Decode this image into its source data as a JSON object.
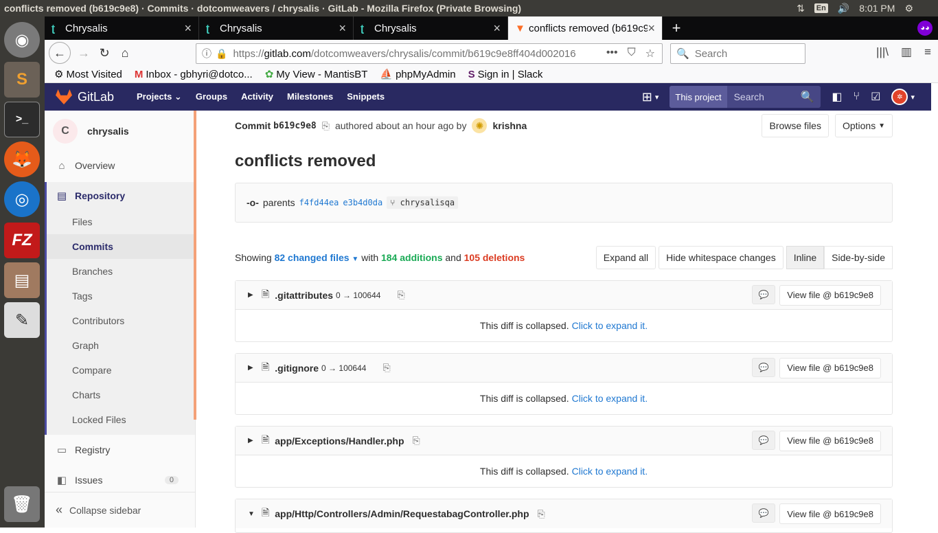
{
  "os": {
    "window_title": "conflicts removed (b619c9e8) · Commits · dotcomweavers / chrysalis · GitLab - Mozilla Firefox (Private Browsing)",
    "lang": "En",
    "clock": "8:01 PM"
  },
  "launcher": {
    "apps": [
      "ubuntu-dash",
      "sublime-text",
      "terminal",
      "firefox",
      "chromium",
      "filezilla",
      "file-manager",
      "text-editor",
      "trash"
    ]
  },
  "browser": {
    "tabs": [
      {
        "label": "Chrysalis"
      },
      {
        "label": "Chrysalis"
      },
      {
        "label": "Chrysalis"
      },
      {
        "label": "conflicts removed (b619c9e8)"
      }
    ],
    "url_prefix": "https://",
    "url_domain": "gitlab.com",
    "url_path": "/dotcomweavers/chrysalis/commit/b619c9e8ff404d002016",
    "search_placeholder": "Search",
    "bookmarks": [
      "Most Visited",
      "Inbox - gbhyri@dotco...",
      "My View - MantisBT",
      "phpMyAdmin",
      "Sign in | Slack"
    ]
  },
  "gitlab": {
    "brand": "GitLab",
    "nav": [
      "Projects",
      "Groups",
      "Activity",
      "Milestones",
      "Snippets"
    ],
    "search_scope": "This project",
    "search_placeholder": "Search"
  },
  "sidebar": {
    "project_initial": "C",
    "project_name": "chrysalis",
    "overview": "Overview",
    "repository": "Repository",
    "repo_items": [
      "Files",
      "Commits",
      "Branches",
      "Tags",
      "Contributors",
      "Graph",
      "Compare",
      "Charts",
      "Locked Files"
    ],
    "registry": "Registry",
    "issues": "Issues",
    "issues_count": "0",
    "collapse": "Collapse sidebar"
  },
  "commit": {
    "label": "Commit",
    "sha": "b619c9e8",
    "authored": "authored about an hour ago by",
    "author": "krishna",
    "browse_files": "Browse files",
    "options": "Options",
    "title": "conflicts removed",
    "parents_label": "parents",
    "parent1": "f4fd44ea",
    "parent2": "e3b4d0da",
    "branch": "chrysalisqa"
  },
  "diffstats": {
    "showing": "Showing",
    "changed": "82 changed files",
    "with": "with",
    "additions": "184 additions",
    "and": "and",
    "deletions": "105 deletions",
    "expand_all": "Expand all",
    "hide_ws": "Hide whitespace changes",
    "inline": "Inline",
    "side_by_side": "Side-by-side"
  },
  "files": [
    {
      "name": ".gitattributes",
      "mode": "0 → 100644",
      "view": "View file @ b619c9e8",
      "collapsed": "This diff is collapsed.",
      "expand": "Click to expand it."
    },
    {
      "name": ".gitignore",
      "mode": "0 → 100644",
      "view": "View file @ b619c9e8",
      "collapsed": "This diff is collapsed.",
      "expand": "Click to expand it."
    },
    {
      "name": "app/Exceptions/Handler.php",
      "mode": "",
      "view": "View file @ b619c9e8",
      "collapsed": "This diff is collapsed.",
      "expand": "Click to expand it."
    },
    {
      "name": "app/Http/Controllers/Admin/RequestabagController.php",
      "mode": "",
      "view": "View file @ b619c9e8",
      "collapsed": "",
      "expand": ""
    }
  ]
}
